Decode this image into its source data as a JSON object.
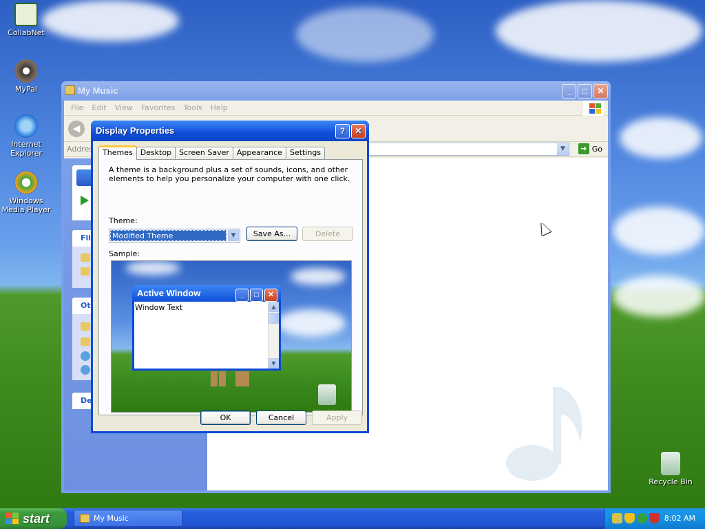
{
  "desktop": {
    "icons": [
      {
        "label": "CollabNet",
        "icon": "collabnet-icon"
      },
      {
        "label": "MyPal",
        "icon": "mypal-icon"
      },
      {
        "label": "Internet Explorer",
        "icon": "internet-explorer-icon"
      },
      {
        "label": "Windows Media Player",
        "icon": "windows-media-player-icon"
      },
      {
        "label": "Recycle Bin",
        "icon": "recycle-bin-icon"
      }
    ]
  },
  "my_music": {
    "title": "My Music",
    "menu": [
      "File",
      "Edit",
      "View",
      "Favorites",
      "Tools",
      "Help"
    ],
    "address_label": "Address",
    "go_label": "Go",
    "left_pane": {
      "sections": [
        "File",
        "Ot",
        "De"
      ]
    }
  },
  "dialog": {
    "title": "Display Properties",
    "tabs": [
      "Themes",
      "Desktop",
      "Screen Saver",
      "Appearance",
      "Settings"
    ],
    "active_tab": "Themes",
    "description": "A theme is a background plus a set of sounds, icons, and other elements to help you personalize your computer with one click.",
    "theme_label": "Theme:",
    "theme_value": "Modified Theme",
    "save_as_label": "Save As...",
    "delete_label": "Delete",
    "sample_label": "Sample:",
    "sample": {
      "window_title": "Active Window",
      "window_text": "Window Text"
    },
    "ok_label": "OK",
    "cancel_label": "Cancel",
    "apply_label": "Apply"
  },
  "taskbar": {
    "start_label": "start",
    "tasks": [
      "My Music"
    ],
    "clock": "8:02 AM"
  },
  "colors": {
    "xp_blue": "#0b49d6",
    "start_green": "#37923a",
    "tray_blue": "#1590e3"
  }
}
